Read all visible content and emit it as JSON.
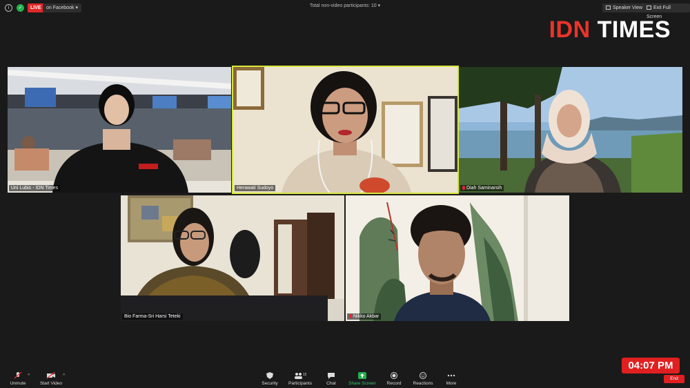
{
  "topbar": {
    "live_label": "LIVE",
    "facebook_label": "on Facebook",
    "nonvideo_label": "Total non-video participants: 10",
    "speaker_view_label": "Speaker View",
    "exit_fullscreen_label": "Exit Full Screen"
  },
  "logo": {
    "part1": "IDN",
    "part2": " TIMES"
  },
  "participants": [
    {
      "name": "Uni Lubis - IDN Times",
      "muted": false
    },
    {
      "name": "Herawati Sudoyo",
      "muted": false
    },
    {
      "name": "Diah Saminarsih",
      "muted": true
    },
    {
      "name": "Bio Farma-Sri Harsi Teteki",
      "muted": false
    },
    {
      "name": "Nikko Akbar",
      "muted": true
    }
  ],
  "toolbar": {
    "unmute": "Unmute",
    "start_video": "Start Video",
    "security": "Security",
    "participants": "Participants",
    "participants_count": "15",
    "chat": "Chat",
    "share_screen": "Share Screen",
    "record": "Record",
    "reactions": "Reactions",
    "more": "More",
    "end": "End"
  },
  "clock": "04:07 PM",
  "colors": {
    "live_red": "#e02828",
    "active_border": "#d8e83a",
    "share_green": "#23b14d",
    "brand_red": "#e8342c"
  }
}
